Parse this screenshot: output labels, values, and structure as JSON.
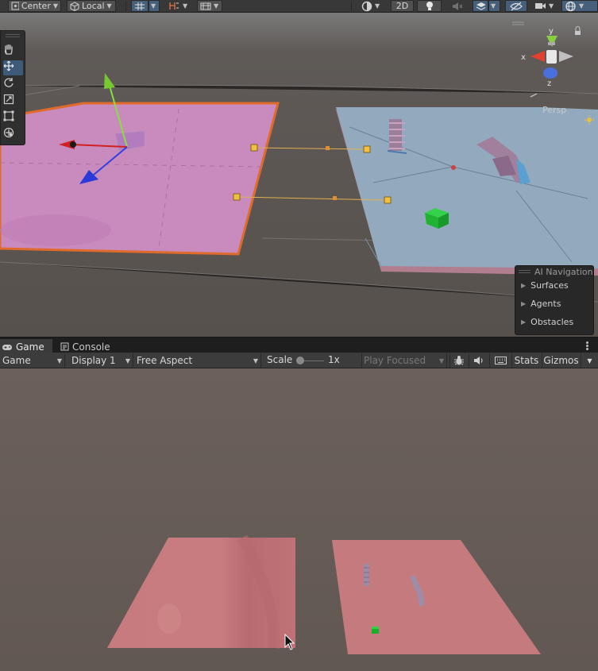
{
  "scene_toolbar": {
    "pivot_label": "Center",
    "space_label": "Local",
    "mode_2d_label": "2D"
  },
  "scene": {
    "persp_label": "Persp",
    "gizmo_axes": {
      "x": "x",
      "y": "y",
      "z": "z"
    },
    "tools": [
      "hand-tool",
      "move-tool",
      "rotate-tool",
      "scale-tool",
      "rect-tool",
      "transform-tool"
    ],
    "active_tool": "move-tool",
    "colors": {
      "pink_plane": "#c98bbd",
      "pink_outline": "#e06a2a",
      "blue_plane": "#93aabe",
      "ground": "#5f5955"
    }
  },
  "ai_navigation": {
    "title": "AI Navigation",
    "items": [
      "Surfaces",
      "Agents",
      "Obstacles"
    ]
  },
  "tabs": [
    {
      "label": "Game",
      "active": true
    },
    {
      "label": "Console",
      "active": false
    }
  ],
  "game_toolbar": {
    "view_mode": "Game",
    "display": "Display 1",
    "aspect": "Free Aspect",
    "scale_label": "Scale",
    "scale_value": "1x",
    "play_mode": "Play Focused",
    "stats_label": "Stats",
    "gizmos_label": "Gizmos"
  },
  "game": {
    "colors": {
      "background": "#6a605b",
      "plane": "#c57a7e",
      "cube": "#1ab02a"
    }
  }
}
